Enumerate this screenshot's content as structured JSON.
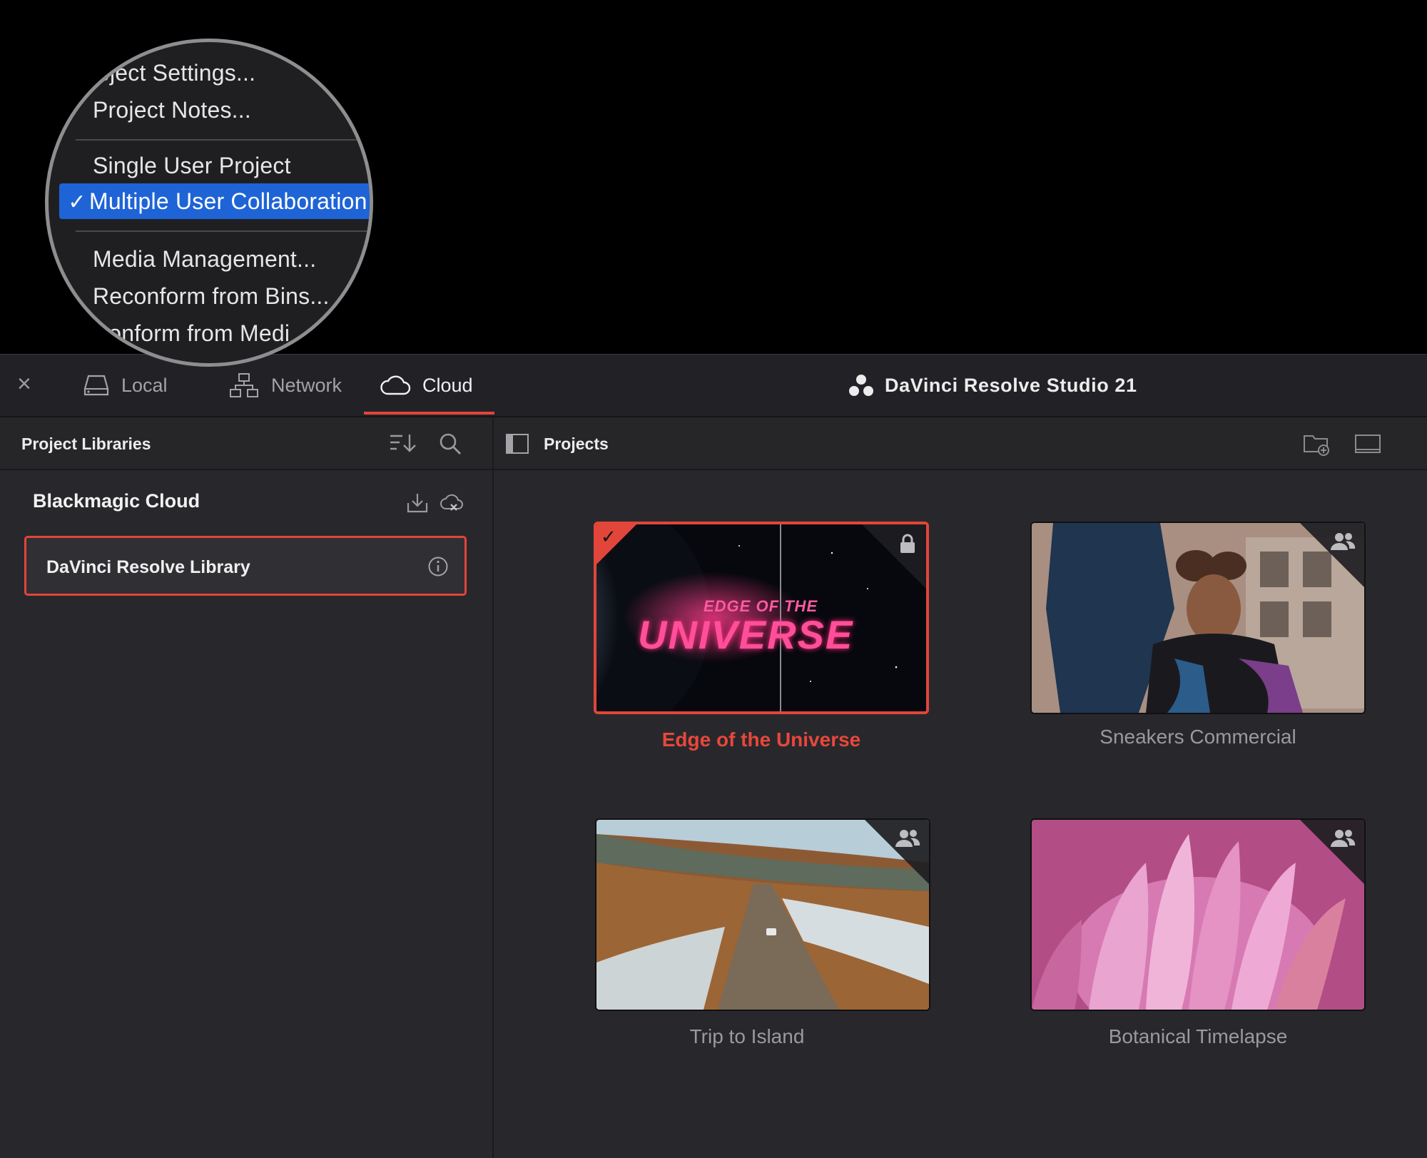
{
  "menu": {
    "items_top": [
      "oject Settings...",
      "Project Notes..."
    ],
    "single_user": "Single User Project",
    "multi_user": "Multiple User Collaboration",
    "checkmark": "✓",
    "items_bottom": [
      "Media Management...",
      "Reconform from Bins...",
      "conform from Medi"
    ]
  },
  "topbar": {
    "close": "×",
    "tabs": [
      "Local",
      "Network",
      "Cloud"
    ],
    "active_tab": "Cloud",
    "app_title": "DaVinci Resolve Studio 21"
  },
  "left_panel": {
    "title": "Project Libraries",
    "group_title": "Blackmagic Cloud",
    "library_name": "DaVinci Resolve  Library"
  },
  "right_panel": {
    "title": "Projects",
    "projects": [
      {
        "title": "Edge of the Universe",
        "thumb_text_top": "EDGE OF THE",
        "thumb_text_main": "UNIVERSE",
        "selected": true,
        "badge": "lock-icon"
      },
      {
        "title": "Sneakers Commercial",
        "selected": false,
        "badge": "users-icon"
      },
      {
        "title": "Trip to Island",
        "selected": false,
        "badge": "users-icon"
      },
      {
        "title": "Botanical Timelapse",
        "selected": false,
        "badge": "users-icon"
      }
    ]
  },
  "colors": {
    "accent": "#e2453a",
    "menu_highlight": "#1e64d6",
    "background": "#28282c"
  }
}
